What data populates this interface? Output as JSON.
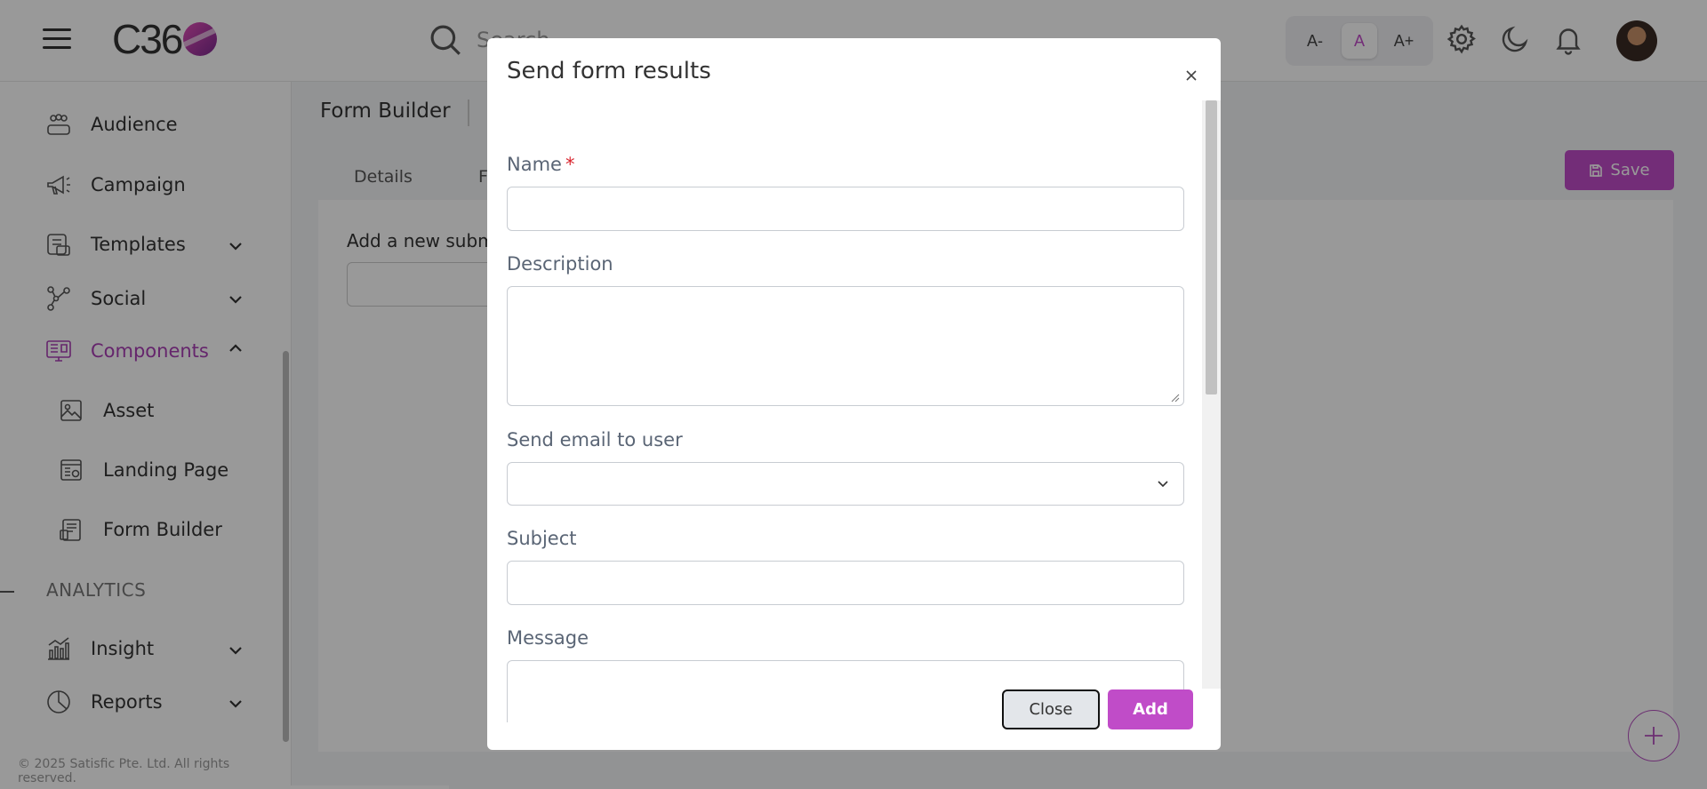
{
  "header": {
    "logo_text": "C36",
    "search_placeholder": "Search",
    "font_controls": [
      "A-",
      "A",
      "A+"
    ]
  },
  "sidebar": {
    "items": [
      {
        "label": "Audience",
        "icon": "audience-icon"
      },
      {
        "label": "Campaign",
        "icon": "megaphone-icon"
      },
      {
        "label": "Templates",
        "icon": "templates-icon",
        "expandable": true
      },
      {
        "label": "Social",
        "icon": "social-icon",
        "expandable": true
      },
      {
        "label": "Components",
        "icon": "components-icon",
        "expanded": true,
        "active": true
      },
      {
        "label": "Asset",
        "icon": "image-icon",
        "sub": true
      },
      {
        "label": "Landing Page",
        "icon": "landing-page-icon",
        "sub": true
      },
      {
        "label": "Form Builder",
        "icon": "form-icon",
        "sub": true
      }
    ],
    "section_label": "ANALYTICS",
    "analytics_items": [
      {
        "label": "Insight",
        "icon": "chart-icon",
        "expandable": true
      },
      {
        "label": "Reports",
        "icon": "pie-icon",
        "expandable": true
      }
    ],
    "footer": "© 2025 Satisfic Pte. Ltd. All rights reserved."
  },
  "main": {
    "title": "Form Builder",
    "tabs": [
      "Details",
      "F"
    ],
    "save_label": "Save",
    "content_label": "Add a new submi"
  },
  "modal": {
    "title": "Send form results",
    "fields": {
      "name_label": "Name",
      "name_required_mark": "*",
      "name_value": "",
      "description_label": "Description",
      "description_value": "",
      "send_email_label": "Send email to user",
      "send_email_value": "",
      "subject_label": "Subject",
      "subject_value": "",
      "message_label": "Message",
      "message_value": ""
    },
    "close_label": "Close",
    "add_label": "Add"
  },
  "colors": {
    "accent": "#c04cc8",
    "active_text": "#a93fb5",
    "required": "#d9262f"
  }
}
